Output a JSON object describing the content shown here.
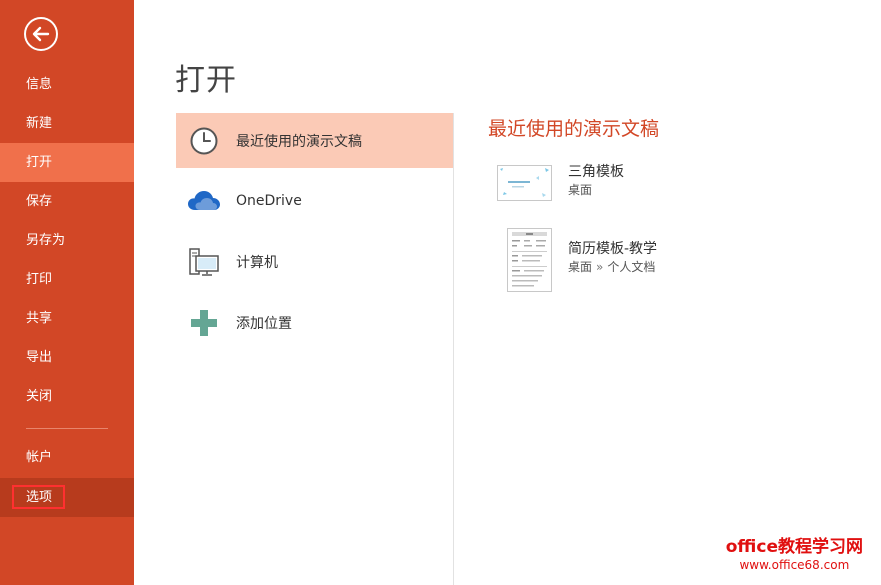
{
  "sidebar": {
    "items": [
      {
        "label": "信息"
      },
      {
        "label": "新建"
      },
      {
        "label": "打开"
      },
      {
        "label": "保存"
      },
      {
        "label": "另存为"
      },
      {
        "label": "打印"
      },
      {
        "label": "共享"
      },
      {
        "label": "导出"
      },
      {
        "label": "关闭"
      }
    ],
    "account": {
      "label": "帐户"
    },
    "options": {
      "label": "选项"
    }
  },
  "main": {
    "title": "打开",
    "places": [
      {
        "label": "最近使用的演示文稿",
        "icon": "clock-icon"
      },
      {
        "label": "OneDrive",
        "icon": "cloud-icon"
      },
      {
        "label": "计算机",
        "icon": "computer-icon"
      },
      {
        "label": "添加位置",
        "icon": "plus-icon"
      }
    ]
  },
  "recent": {
    "title": "最近使用的演示文稿",
    "files": [
      {
        "name": "三角模板",
        "path": [
          "桌面"
        ]
      },
      {
        "name": "简历模板-教学",
        "path": [
          "桌面",
          "»",
          "个人文档"
        ]
      }
    ]
  },
  "watermark": {
    "line1": "office教程学习网",
    "line2": "www.office68.com"
  },
  "colors": {
    "sidebar": "#d24726",
    "sidebar_active": "#f0704b",
    "place_active": "#fbcab6",
    "accent": "#d24726"
  }
}
